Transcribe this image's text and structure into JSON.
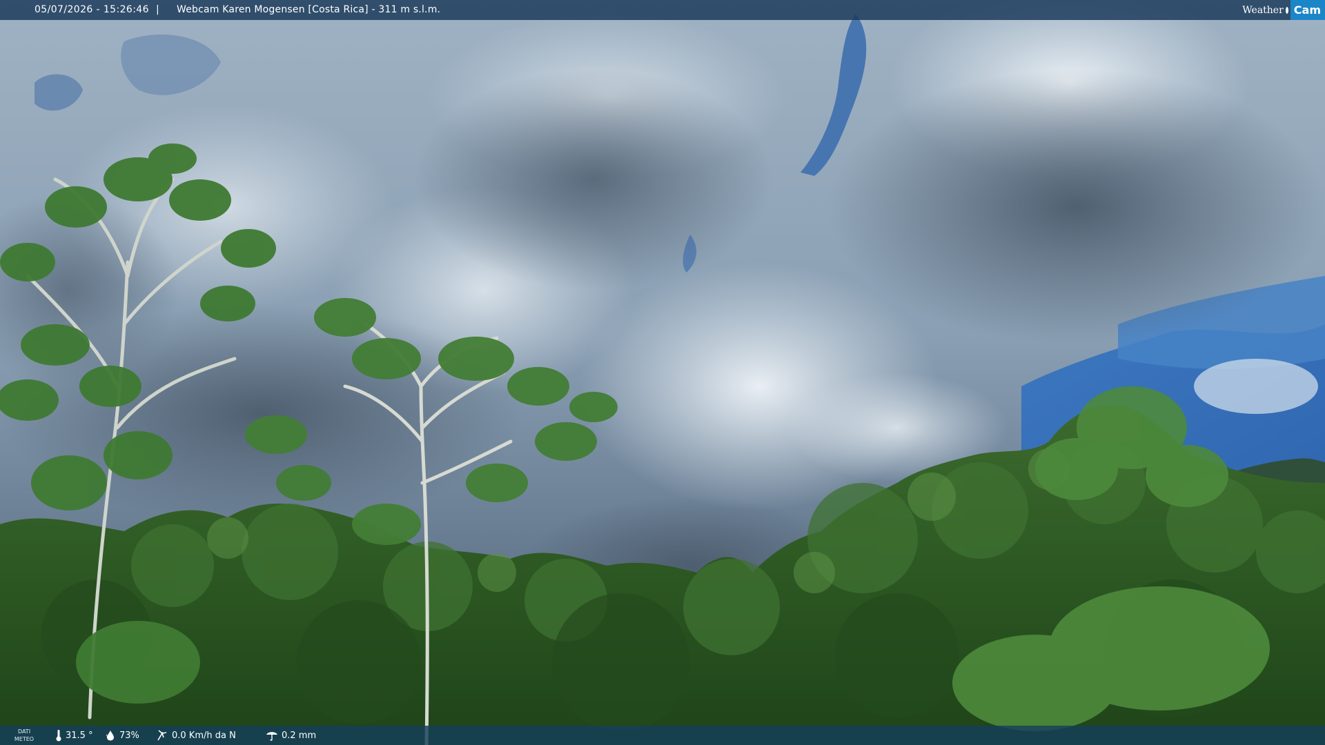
{
  "header": {
    "datetime": "05/07/2026 - 15:26:46",
    "separator": "|",
    "title": "Webcam Karen Mogensen [Costa Rica]  - 311 m s.l.m."
  },
  "logo": {
    "weather": "Weather",
    "cam": "Cam"
  },
  "footer": {
    "dati_line1": "DATI",
    "dati_line2": "METEO",
    "temperature": "31.5 °",
    "humidity": "73%",
    "wind": "0.0 Km/h da N",
    "rain": "0.2 mm"
  },
  "icons": {
    "temperature": "thermometer-icon",
    "humidity": "drop-icon",
    "wind": "wind-icon",
    "rain": "umbrella-icon"
  },
  "colors": {
    "header_bar": "#1c3a5c",
    "logo_blue": "#1b86c7",
    "footer_bar": "#16405c"
  }
}
